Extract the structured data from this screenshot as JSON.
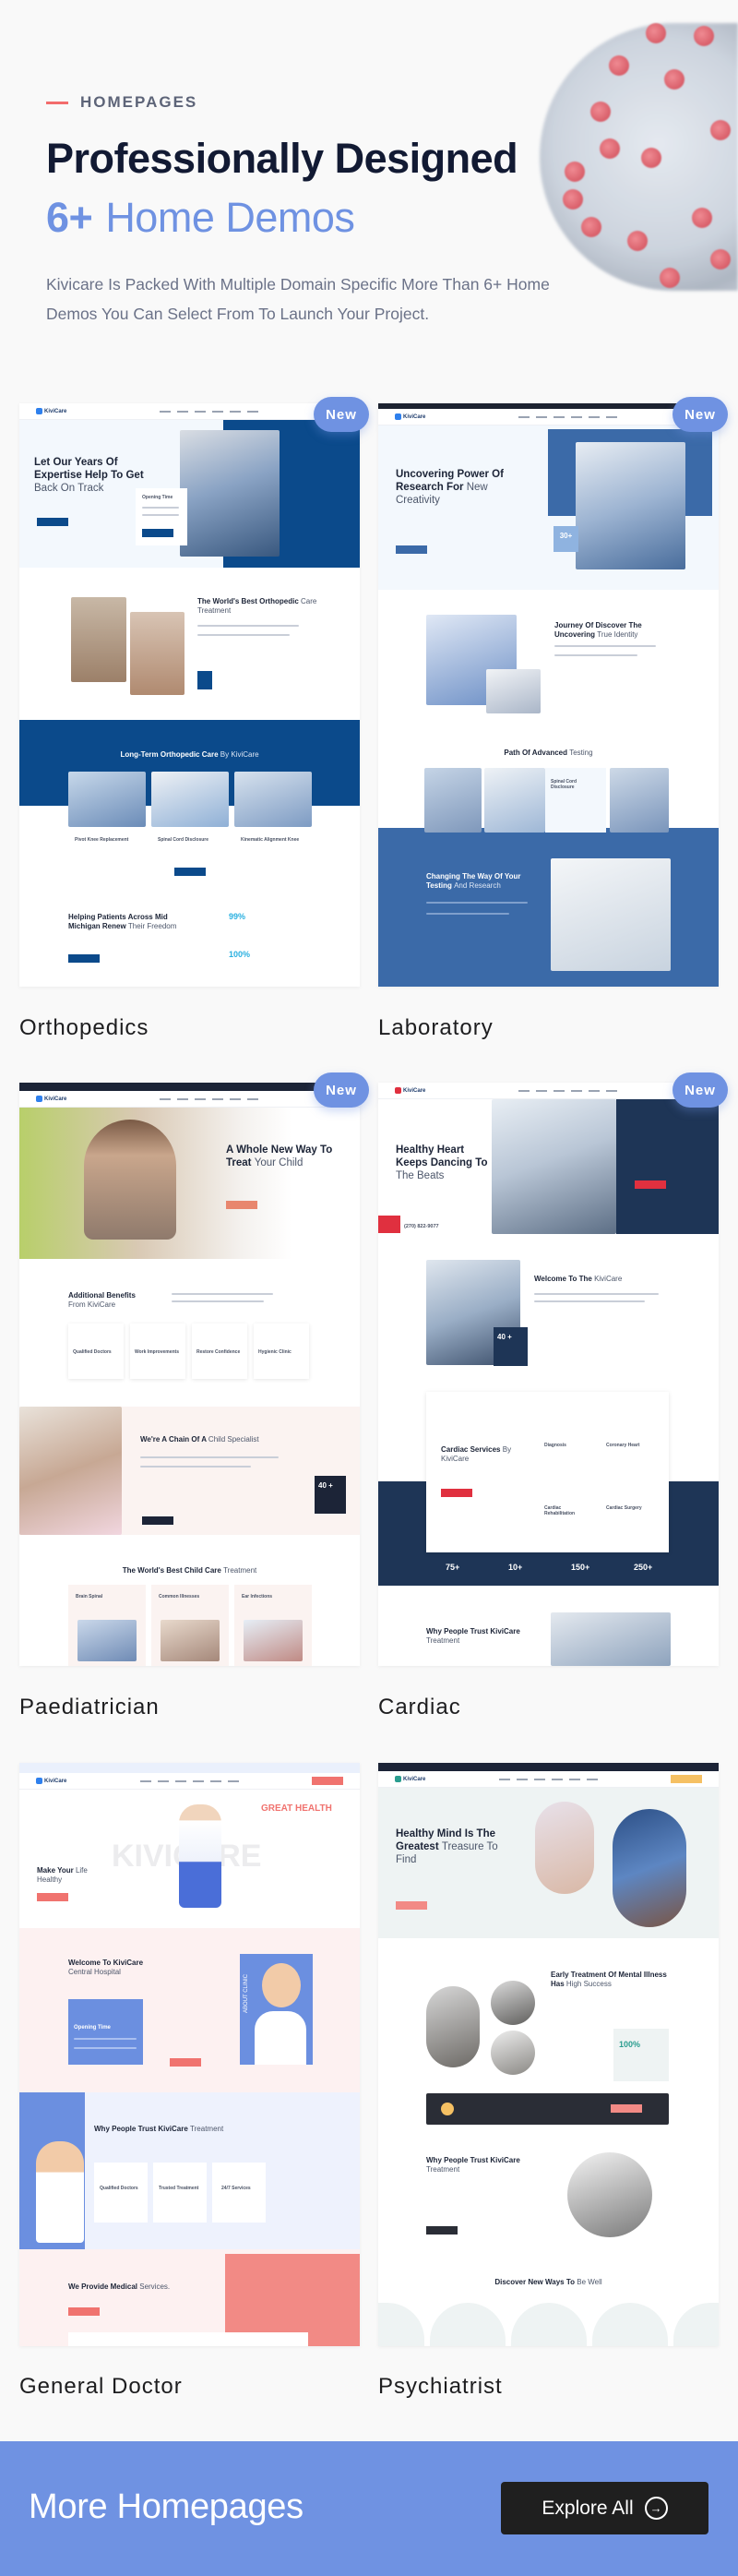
{
  "header": {
    "eyebrow": "HOMEPAGES",
    "title_line1": "Professionally Designed",
    "title_count": "6+",
    "title_rest": "Home Demos",
    "description": "Kivicare Is Packed With Multiple Domain Specific More Than 6+ Home Demos You Can Select From To Launch Your Project."
  },
  "colors": {
    "accent": "#6f92e2",
    "eyebrow_line": "#f26c6c",
    "title": "#121a33",
    "button": "#1f1f1f"
  },
  "demos": [
    {
      "label": "Orthopedics",
      "badge": "New",
      "logo": "KiviCare",
      "hero_bold": "Let Our Years Of Expertise Help To Get",
      "hero_light": "Back On Track",
      "opening": "Opening Time",
      "s2_bold": "The World's Best Orthopedic",
      "s2_light": "Care Treatment",
      "s3_bold": "Long-Term Orthopedic Care",
      "s3_light": "By KiviCare",
      "services": [
        "Pivot Knee Replacement",
        "Spinal Cord Disclosure",
        "Kinematic Alignment Knee"
      ],
      "s4_bold": "Helping Patients Across Mid Michigan Renew",
      "s4_light": "Their Freedom",
      "stats": [
        "99%",
        "100%"
      ]
    },
    {
      "label": "Laboratory",
      "badge": "New",
      "logo": "KiviCare",
      "hero_bold": "Uncovering Power Of Research For",
      "hero_light": "New Creativity",
      "hero_stat": "30+",
      "s2_bold": "Journey Of Discover The Uncovering",
      "s2_light": "True Identity",
      "s3_bold": "Path Of Advanced",
      "s3_light": "Testing",
      "s3_card": "Spinal Cord Disclosure",
      "s4_bold": "Changing The Way Of Your Testing",
      "s4_light": "And Research"
    },
    {
      "label": "Paediatrician",
      "badge": "New",
      "logo": "KiviCare",
      "hero_bold": "A Whole New Way To Treat",
      "hero_light": "Your Child",
      "s2_bold": "Additional Benefits",
      "s2_light": "From KiviCare",
      "benefits": [
        "Qualified Doctors",
        "Work Improvements",
        "Restore Confidence",
        "Hygienic Clinic"
      ],
      "s3_bold": "We're A Chain Of A",
      "s3_light": "Child Specialist",
      "s3_stat": "40 +",
      "s4_bold": "The World's Best Child Care",
      "s4_light": "Treatment",
      "services": [
        "Brain Spinal",
        "Common Illnesses",
        "Ear Infections"
      ]
    },
    {
      "label": "Cardiac",
      "badge": "New",
      "logo": "KiviCare",
      "hero_bold": "Healthy Heart Keeps Dancing To",
      "hero_light": "The Beats",
      "phone": "(270) 822-9077",
      "s2_bold": "Welcome To The",
      "s2_light": "KiviCare",
      "s2_stat": "40 +",
      "s3_bold": "Cardiac Services",
      "s3_light": "By KiviCare",
      "services": [
        "Diagnosis",
        "Coronary Heart",
        "Cardiac Rehabilitation",
        "Cardiac Surgery"
      ],
      "stats": [
        "75+",
        "10+",
        "150+",
        "250+"
      ],
      "s4_bold": "Why People Trust KiviCare",
      "s4_light": "Treatment"
    },
    {
      "label": "General Doctor",
      "logo": "KiviCare",
      "hero_tag": "GREAT HEALTH",
      "hero_watermark": "KIVICARE",
      "hero_bold": "Make Your",
      "hero_light": "Life Healthy",
      "s2_bold": "Welcome To KiviCare",
      "s2_light": "Central Hospital",
      "opening": "Opening Time",
      "about": "ABOUT CLINIC",
      "s3_bold": "Why People Trust KiviCare",
      "s3_light": "Treatment",
      "features": [
        "Qualified Doctors",
        "Trusted Treatment",
        "24/7 Services"
      ],
      "s4_bold": "We Provide Medical",
      "s4_light": "Services."
    },
    {
      "label": "Psychiatrist",
      "logo": "KiviCare",
      "hero_bold": "Healthy Mind Is The Greatest",
      "hero_light": "Treasure To Find",
      "s2_bold": "Early Treatment Of Mental Illness Has",
      "s2_light": "High Success",
      "s2_stat": "100%",
      "s3_bold": "Why People Trust KiviCare",
      "s3_light": "Treatment",
      "s4_bold": "Discover New Ways To",
      "s4_light": "Be Well"
    }
  ],
  "footer": {
    "title": "More Homepages",
    "button": "Explore All",
    "button_icon": "arrow-right-circle-icon"
  }
}
